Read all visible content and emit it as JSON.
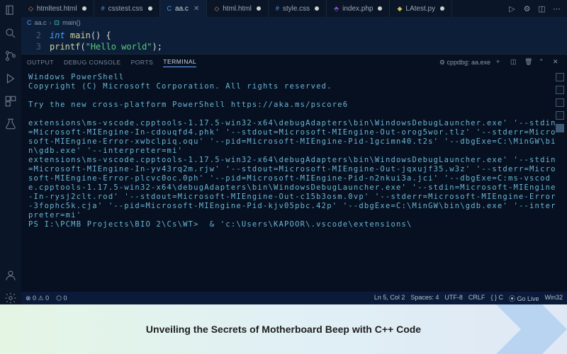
{
  "tabs": [
    {
      "icon": "◇",
      "iconClass": "fi-orange",
      "label": "htmltest.html",
      "active": false,
      "dot": true
    },
    {
      "icon": "#",
      "iconClass": "fi-blue",
      "label": "csstest.css",
      "active": false,
      "dot": true
    },
    {
      "icon": "C",
      "iconClass": "fi-blue",
      "label": "aa.c",
      "active": true,
      "close": true
    },
    {
      "icon": "◇",
      "iconClass": "fi-orange",
      "label": "html.html",
      "active": false,
      "dot": true
    },
    {
      "icon": "#",
      "iconClass": "fi-blue",
      "label": "style.css",
      "active": false,
      "dot": true
    },
    {
      "icon": "⬘",
      "iconClass": "fi-purple",
      "label": "index.php",
      "active": false,
      "dot": true
    },
    {
      "icon": "◆",
      "iconClass": "fi-yellow",
      "label": "LAtest.py",
      "active": false,
      "dot": true
    }
  ],
  "breadcrumb": {
    "file": "aa.c",
    "symbol": "main()"
  },
  "editor": {
    "lines": [
      {
        "num": "2",
        "html": "<span class='kw'>int</span> <span class='fn'>main</span><span class='paren'>() {</span>"
      },
      {
        "num": "3",
        "html": "  <span class='fn'>printf</span><span class='paren'>(</span><span class='str'>\"Hello world\"</span><span class='paren'>);</span>"
      }
    ]
  },
  "panel": {
    "tabs": [
      "OUTPUT",
      "DEBUG CONSOLE",
      "PORTS",
      "TERMINAL"
    ],
    "active": "TERMINAL",
    "launch_label": "cppdbg: aa.exe"
  },
  "terminal": {
    "lines": [
      "Windows PowerShell",
      "Copyright (C) Microsoft Corporation. All rights reserved.",
      "",
      "Try the new cross-platform PowerShell https://aka.ms/pscore6",
      "",
      "extensions\\ms-vscode.cpptools-1.17.5-win32-x64\\debugAdapters\\bin\\WindowsDebugLauncher.exe' '--stdin=Microsoft-MIEngine-In-cdouqfd4.phk' '--stdout=Microsoft-MIEngine-Out-orog5wor.tlz' '--stderr=Microsoft-MIEngine-Error-xwbclpiq.oqu' '--pid=Microsoft-MIEngine-Pid-1gcimn40.t2s' '--dbgExe=C:\\MinGW\\bin\\gdb.exe' '--interpreter=mi'",
      "extensions\\ms-vscode.cpptools-1.17.5-win32-x64\\debugAdapters\\bin\\WindowsDebugLauncher.exe' '--stdin=Microsoft-MIEngine-In-yv43rq2m.rjw' '--stdout=Microsoft-MIEngine-Out-jqxujf35.w3z' '--stderr=Microsoft-MIEngine-Error-plcvc0oc.0ph' '--pid=Microsoft-MIEngine-Pid-n2nkui3a.jci' '--dbgExe=C:ms-vscode.cpptools-1.17.5-win32-x64\\debugAdapters\\bin\\WindowsDebugLauncher.exe' '--stdin=Microsoft-MIEngine-In-rysj2clt.rod' '--stdout=Microsoft-MIEngine-Out-c15b3osm.0vp' '--stderr=Microsoft-MIEngine-Error-3fophc5k.cja' '--pid=Microsoft-MIEngine-Pid-kjv05pbc.42p' '--dbgExe=C:\\MinGW\\bin\\gdb.exe' '--interpreter=mi'",
      "PS I:\\PCMB Projects\\BIO 2\\Cs\\WT>  & 'c:\\Users\\KAPOOR\\.vscode\\extensions\\"
    ]
  },
  "status": {
    "left": [
      "⊗ 0 ⚠ 0",
      "⬡ 0"
    ],
    "right": [
      "Ln 5, Col 2",
      "Spaces: 4",
      "UTF-8",
      "CRLF",
      "{ }  C",
      "⦿ Go Live",
      "Win32"
    ]
  },
  "banner": {
    "text": "Unveiling the Secrets of Motherboard Beep with C++ Code"
  }
}
